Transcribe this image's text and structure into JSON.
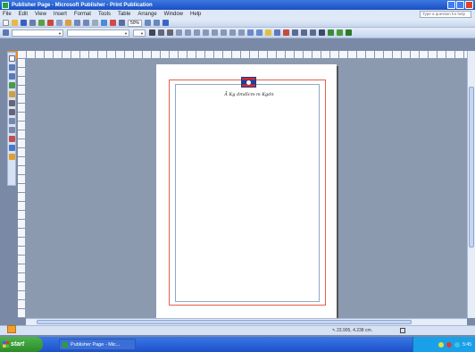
{
  "window": {
    "title": "Publisher Page - Microsoft Publisher - Print Publication",
    "colors": {
      "titlebar": "#1a4fc4",
      "close": "#d8462a"
    }
  },
  "menubar": {
    "items": [
      "File",
      "Edit",
      "View",
      "Insert",
      "Format",
      "Tools",
      "Table",
      "Arrange",
      "Window",
      "Help"
    ],
    "help_placeholder": "Type a question for help"
  },
  "toolbar": {
    "zoom": "50%"
  },
  "document": {
    "flag_icon": "laos-flag-icon",
    "motto": "Ẫ Kg dmdîcm-m Kgdn"
  },
  "statusbar": {
    "coordinates": "23.905, 4.238 cm."
  },
  "taskbar": {
    "start_label": "start",
    "task_label": "Publisher Page - Mic...",
    "clock": "5:45"
  }
}
